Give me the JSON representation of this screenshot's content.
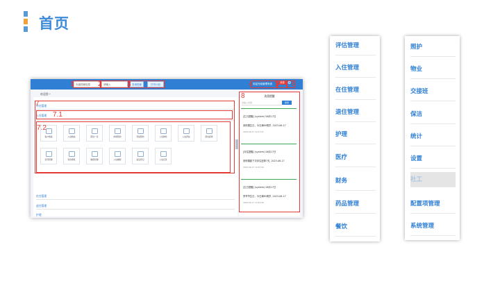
{
  "page": {
    "title": "首页"
  },
  "screenshot": {
    "breadcrumb": "欢迎您～",
    "toolbar": {
      "org_select": "长者档案信息",
      "search_placeholder": "请输入",
      "btn_search": "查询档案",
      "btn_print": "打印计划",
      "user_text": "欢迎光临管理系统",
      "badge_text": "消息"
    },
    "labels": [
      "1",
      "2",
      "3",
      "4",
      "5",
      "6",
      "7",
      "7.1",
      "7.2",
      "8"
    ],
    "left_menu": {
      "assess": "评估管理",
      "checkin": "入住管理",
      "inhouse": "在住管理",
      "checkout": "退住管理",
      "care": "护理"
    },
    "tiles": [
      "客户档案",
      "入住档案",
      "床位一览",
      "体验预约",
      "评估预约",
      "入住体检",
      "入住评估",
      "床位提供",
      "合同管理",
      "签约审核",
      "缴费管理",
      "入住缴费",
      "退住登记",
      "入住记录"
    ],
    "notice": {
      "title": "消息提醒",
      "search_placeholder": "请输入内容",
      "btn": "搜索",
      "cards": [
        {
          "tag": "[生日提醒] (system) 06月17日",
          "body": "张阿姨生日，今日满89周岁, 2023-06-17",
          "date": "2023-06-17 14:17:37"
        },
        {
          "tag": "[评估提醒] (system) 06月17日",
          "body": "张阿姨距下次评估还剩7天, 2023-06-17",
          "date": "2023-06-17 14:07:00"
        },
        {
          "tag": "[生日提醒] (system) 06月17日",
          "body": "李爷爷生日，今日满85周岁, 2023-06-17",
          "date": "2023-06-17 13:52:28"
        }
      ]
    }
  },
  "menu_left": [
    "评估管理",
    "入住管理",
    "在住管理",
    "退住管理",
    "护理",
    "医疗",
    "财务",
    "药品管理",
    "餐饮"
  ],
  "menu_right": [
    "照护",
    "物业",
    "交接班",
    "保洁",
    "统计",
    "设置",
    "社工",
    "配置项管理",
    "系统管理"
  ],
  "menu_right_active": "社工"
}
